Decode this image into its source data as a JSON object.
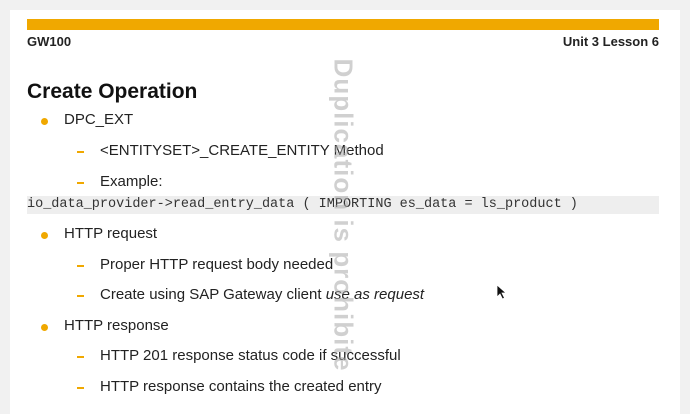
{
  "header": {
    "course_code": "GW100",
    "unit_label": "Unit 3 Lesson 6"
  },
  "slide": {
    "title": "Create Operation",
    "items": [
      {
        "level": 1,
        "text": "DPC_EXT"
      },
      {
        "level": 2,
        "text": "<ENTITYSET>_CREATE_ENTITY Method"
      },
      {
        "level": 2,
        "text": "Example:"
      },
      {
        "level": 0,
        "text": "io_data_provider->read_entry_data ( IMPORTING es_data = ls_product )"
      },
      {
        "level": 1,
        "text": "HTTP request"
      },
      {
        "level": 2,
        "text": "Proper HTTP request body needed"
      },
      {
        "level": 2,
        "text": "Create using SAP Gateway client ",
        "italic_suffix": "use as request"
      },
      {
        "level": 1,
        "text": "HTTP response"
      },
      {
        "level": 2,
        "text": "HTTP 201 response status code if successful"
      },
      {
        "level": 2,
        "text": "HTTP response contains the created entry"
      }
    ]
  },
  "watermark": {
    "text": "Duplication is prohibite"
  },
  "colors": {
    "accent": "#f0a800",
    "code_background": "#eeeeee",
    "page_background": "#f1f1f1"
  },
  "icons": {
    "cursor": "mouse-pointer-icon"
  }
}
